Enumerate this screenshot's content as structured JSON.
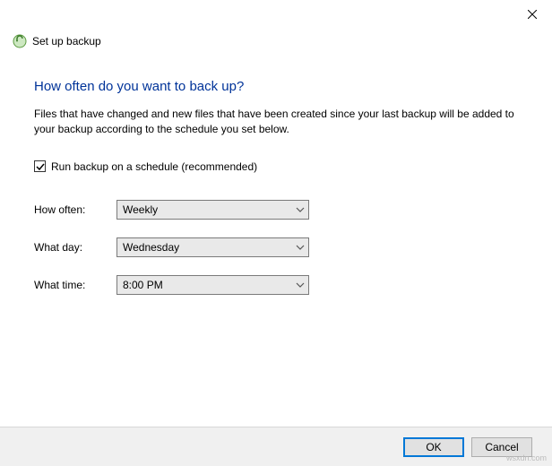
{
  "window": {
    "title": "Set up backup"
  },
  "content": {
    "heading": "How often do you want to back up?",
    "description": "Files that have changed and new files that have been created since your last backup will be added to your backup according to the schedule you set below.",
    "checkbox_label": "Run backup on a schedule (recommended)",
    "checkbox_checked": true,
    "fields": {
      "how_often": {
        "label": "How often:",
        "value": "Weekly"
      },
      "what_day": {
        "label": "What day:",
        "value": "Wednesday"
      },
      "what_time": {
        "label": "What time:",
        "value": "8:00 PM"
      }
    }
  },
  "footer": {
    "ok_label": "OK",
    "cancel_label": "Cancel"
  },
  "watermark": "wsxdn.com"
}
